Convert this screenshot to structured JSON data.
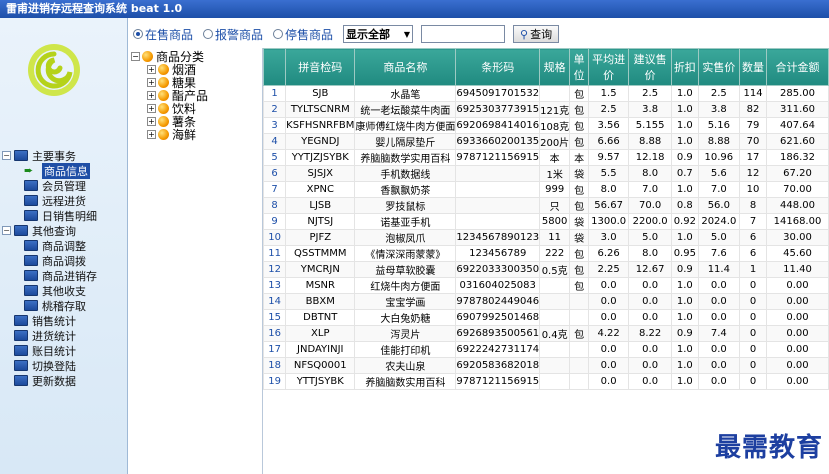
{
  "window": {
    "title": "雷甫进销存远程查询系统 beat 1.0"
  },
  "toolbar": {
    "radios": [
      {
        "label": "在售商品",
        "selected": true
      },
      {
        "label": "报警商品",
        "selected": false
      },
      {
        "label": "停售商品",
        "selected": false
      }
    ],
    "filter_value": "显示全部",
    "search_value": "",
    "query_label": "查询"
  },
  "nav": {
    "groups": [
      {
        "label": "主要事务",
        "expanded": true,
        "items": [
          {
            "label": "商品信息",
            "selected": true
          },
          {
            "label": "会员管理"
          },
          {
            "label": "远程进货"
          },
          {
            "label": "日销售明细"
          }
        ]
      },
      {
        "label": "其他查询",
        "expanded": true,
        "items": [
          {
            "label": "商品调整"
          },
          {
            "label": "商品调拨"
          },
          {
            "label": "商品进销存"
          },
          {
            "label": "其他收支"
          },
          {
            "label": "桃稽存取"
          }
        ]
      }
    ],
    "top_items": [
      {
        "label": "销售统计"
      },
      {
        "label": "进货统计"
      },
      {
        "label": "账目统计"
      },
      {
        "label": "切换登陆"
      },
      {
        "label": "更新数据"
      }
    ]
  },
  "categories": {
    "root": "商品分类",
    "items": [
      "烟酒",
      "糖果",
      "酯产品",
      "饮料",
      "薯条",
      "海鲜"
    ]
  },
  "table": {
    "columns": [
      "",
      "拼音检码",
      "商品名称",
      "条形码",
      "规格",
      "单位",
      "平均进价",
      "建议售价",
      "折扣",
      "实售价",
      "数量",
      "合计金额"
    ],
    "rows": [
      [
        "1",
        "SJB",
        "水晶笔",
        "6945091701532",
        "",
        "包",
        "1.5",
        "2.5",
        "1.0",
        "2.5",
        "114",
        "285.00"
      ],
      [
        "2",
        "TYLTSCNRM",
        "统一老坛酸菜牛肉面",
        "6925303773915",
        "121克",
        "包",
        "2.5",
        "3.8",
        "1.0",
        "3.8",
        "82",
        "311.60"
      ],
      [
        "3",
        "KSFHSNRFBM",
        "康师傅红烧牛肉方便面",
        "6920698414016",
        "108克",
        "包",
        "3.56",
        "5.155",
        "1.0",
        "5.16",
        "79",
        "407.64"
      ],
      [
        "4",
        "YEGNDJ",
        "婴儿隔尿垫斤",
        "6933660200135",
        "200片",
        "包",
        "6.66",
        "8.88",
        "1.0",
        "8.88",
        "70",
        "621.60"
      ],
      [
        "5",
        "YYTJZJSYBK",
        "养脑脑数学实用百科",
        "9787121156915",
        "本",
        "本",
        "9.57",
        "12.18",
        "0.9",
        "10.96",
        "17",
        "186.32"
      ],
      [
        "6",
        "SJSJX",
        "手机数据线",
        "",
        "1米",
        "袋",
        "5.5",
        "8.0",
        "0.7",
        "5.6",
        "12",
        "67.20"
      ],
      [
        "7",
        "XPNC",
        "香飘飘奶茶",
        "",
        "999",
        "包",
        "8.0",
        "7.0",
        "1.0",
        "7.0",
        "10",
        "70.00"
      ],
      [
        "8",
        "LJSB",
        "罗技鼠标",
        "",
        "只",
        "包",
        "56.67",
        "70.0",
        "0.8",
        "56.0",
        "8",
        "448.00"
      ],
      [
        "9",
        "NJTSJ",
        "诺基亚手机",
        "",
        "5800",
        "袋",
        "1300.0",
        "2200.0",
        "0.92",
        "2024.0",
        "7",
        "14168.00"
      ],
      [
        "10",
        "PJFZ",
        "泡椒凤爪",
        "1234567890123",
        "11",
        "袋",
        "3.0",
        "5.0",
        "1.0",
        "5.0",
        "6",
        "30.00"
      ],
      [
        "11",
        "QSSTMMM",
        "《情深深雨蒙蒙》",
        "123456789",
        "222",
        "包",
        "6.26",
        "8.0",
        "0.95",
        "7.6",
        "6",
        "45.60"
      ],
      [
        "12",
        "YMCRJN",
        "益母草软胶囊",
        "6922033300350",
        "0.5克",
        "包",
        "2.25",
        "12.67",
        "0.9",
        "11.4",
        "1",
        "11.40"
      ],
      [
        "13",
        "MSNR",
        "红烧牛肉方便面",
        "031604025083",
        "",
        "包",
        "0.0",
        "0.0",
        "1.0",
        "0.0",
        "0",
        "0.00"
      ],
      [
        "14",
        "BBXM",
        "宝宝学画",
        "9787802449046",
        "",
        "",
        "0.0",
        "0.0",
        "1.0",
        "0.0",
        "0",
        "0.00"
      ],
      [
        "15",
        "DBTNT",
        "大白兔奶糖",
        "6907992501468",
        "",
        "",
        "0.0",
        "0.0",
        "1.0",
        "0.0",
        "0",
        "0.00"
      ],
      [
        "16",
        "XLP",
        "泻灵片",
        "6926893500561",
        "0.4克",
        "包",
        "4.22",
        "8.22",
        "0.9",
        "7.4",
        "0",
        "0.00"
      ],
      [
        "17",
        "JNDAYINJI",
        "佳能打印机",
        "6922242731174",
        "",
        "",
        "0.0",
        "0.0",
        "1.0",
        "0.0",
        "0",
        "0.00"
      ],
      [
        "18",
        "NFSQ0001",
        "农夫山泉",
        "6920583682018",
        "",
        "",
        "0.0",
        "0.0",
        "1.0",
        "0.0",
        "0",
        "0.00"
      ],
      [
        "19",
        "YTTJSYBK",
        "养脑脑数实用百科",
        "9787121156915",
        "",
        "",
        "0.0",
        "0.0",
        "1.0",
        "0.0",
        "0",
        "0.00"
      ]
    ]
  },
  "watermark": "最需教育",
  "colors": {
    "header_teal": "#2a9a8e",
    "title_blue": "#1d4fa8",
    "accent_orange": "#f59a00"
  }
}
